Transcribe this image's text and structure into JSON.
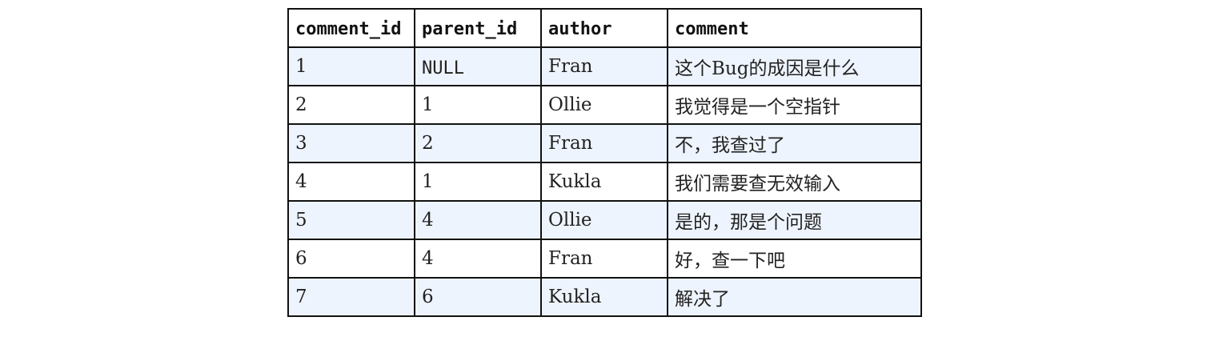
{
  "table": {
    "columns": [
      "comment_id",
      "parent_id",
      "author",
      "comment"
    ],
    "rows": [
      {
        "comment_id": "1",
        "parent_id": "NULL",
        "author": "Fran",
        "comment": "这个Bug的成因是什么"
      },
      {
        "comment_id": "2",
        "parent_id": "1",
        "author": "Ollie",
        "comment": "我觉得是一个空指针"
      },
      {
        "comment_id": "3",
        "parent_id": "2",
        "author": "Fran",
        "comment": "不，我查过了"
      },
      {
        "comment_id": "4",
        "parent_id": "1",
        "author": "Kukla",
        "comment": "我们需要查无效输入"
      },
      {
        "comment_id": "5",
        "parent_id": "4",
        "author": "Ollie",
        "comment": "是的，那是个问题"
      },
      {
        "comment_id": "6",
        "parent_id": "4",
        "author": "Fran",
        "comment": "好，查一下吧"
      },
      {
        "comment_id": "7",
        "parent_id": "6",
        "author": "Kukla",
        "comment": "解决了"
      }
    ]
  },
  "colors": {
    "border": "#111111",
    "header_bg": "#ffffff",
    "odd_row_bg": "#eef4fd",
    "even_row_bg": "#ffffff"
  }
}
